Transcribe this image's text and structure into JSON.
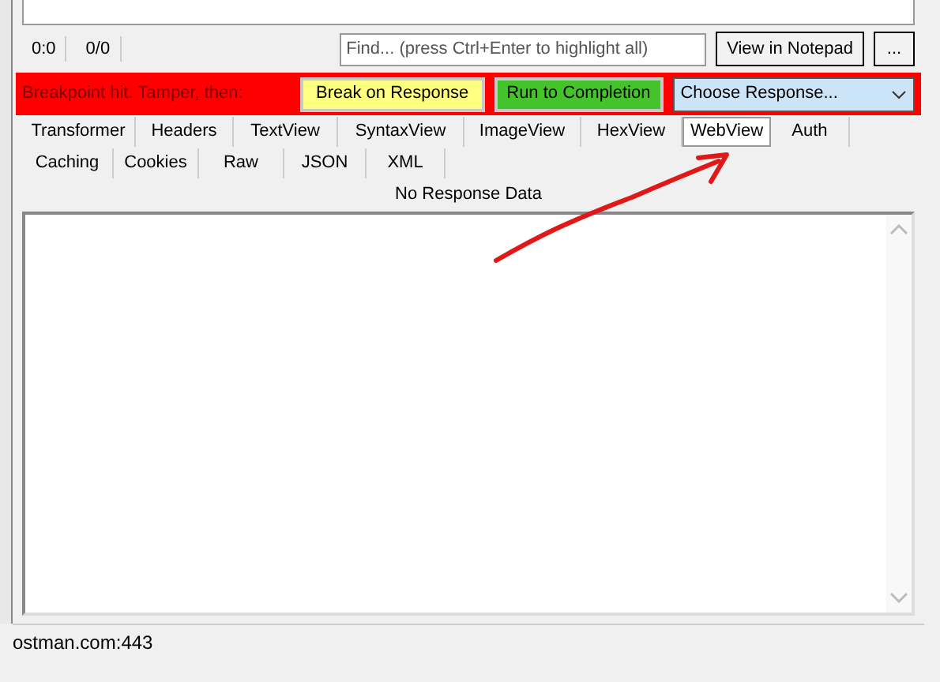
{
  "request_stats": [
    "0:0",
    "0/0"
  ],
  "find_field": {
    "placeholder": "Find... (press Ctrl+Enter to highlight all)"
  },
  "toolbar_buttons": [
    "View in Notepad",
    "..."
  ],
  "breakpoint_bar": {
    "message": "Breakpoint hit. Tamper, then:",
    "break_button": "Break on Response",
    "run_button": "Run to Completion",
    "response_select": "Choose Response..."
  },
  "tab_rows": [
    [
      {
        "label": "Transformer",
        "selected": false
      },
      {
        "label": "Headers",
        "selected": false
      },
      {
        "label": "TextView",
        "selected": false
      },
      {
        "label": "SyntaxView",
        "selected": false
      },
      {
        "label": "ImageView",
        "selected": false
      },
      {
        "label": "HexView",
        "selected": false
      },
      {
        "label": "WebView",
        "selected": true
      },
      {
        "label": "Auth",
        "selected": false
      }
    ],
    [
      {
        "label": "Caching",
        "selected": false
      },
      {
        "label": "Cookies",
        "selected": false
      },
      {
        "label": "Raw",
        "selected": false
      },
      {
        "label": "JSON",
        "selected": false
      },
      {
        "label": "XML",
        "selected": false
      }
    ]
  ],
  "response_status": "No Response Data",
  "status_bar": "ostman.com:443"
}
